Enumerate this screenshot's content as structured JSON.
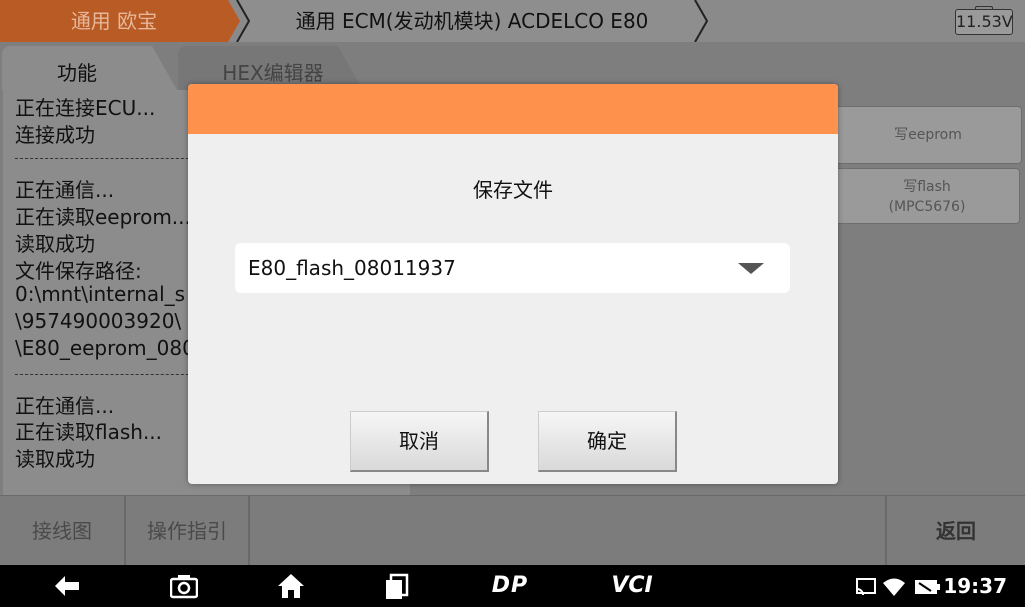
{
  "breadcrumb": {
    "level1": "通用 欧宝",
    "level2": "通用 ECM(发动机模块) ACDELCO E80"
  },
  "battery_voltage": "11.53V",
  "tabs": [
    {
      "label": "功能"
    },
    {
      "label": "HEX编辑器"
    }
  ],
  "log": {
    "lines": [
      "正在连接ECU...",
      "连接成功",
      "正在通信...",
      "正在读取eeprom...",
      "读取成功",
      "文件保存路径:",
      "0:\\mnt\\internal_s",
      "\\957490003920\\",
      "\\E80_eeprom_080",
      "正在通信...",
      "正在读取flash...",
      "读取成功"
    ]
  },
  "right_buttons": {
    "write_eeprom": "写eeprom",
    "write_flash_line1": "写flash",
    "write_flash_line2": "(MPC5676)"
  },
  "bottom_bar": {
    "wiring": "接线图",
    "guide": "操作指引",
    "back": "返回"
  },
  "system_nav": {
    "dp": "DP",
    "vci": "VCI",
    "time": "19:37"
  },
  "dialog": {
    "title": "保存文件",
    "filename_value": "E80_flash_08011937",
    "cancel": "取消",
    "confirm": "确定"
  },
  "colors": {
    "dialog_header": "#fe924d",
    "breadcrumb_active": "#b85b24"
  }
}
